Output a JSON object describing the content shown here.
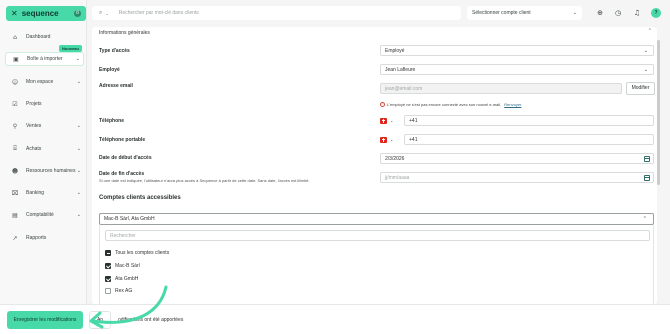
{
  "brand": {
    "name": "sequence",
    "mark": "✕",
    "badge": "8"
  },
  "colors": {
    "accent": "#47d9a8",
    "accent_dark": "#0e3b30",
    "warning": "#d34a3e",
    "link": "#2f6d8a"
  },
  "sidebar": {
    "new_badge": "Nouveau",
    "items": [
      {
        "label": "Dashboard",
        "icon": "home-icon",
        "glyph": "⌂",
        "chevron": false
      },
      {
        "label": "Boîte à importer",
        "icon": "inbox-icon",
        "glyph": "▣",
        "chevron": true
      },
      {
        "label": "Mon espace",
        "icon": "user-icon",
        "glyph": "☺",
        "chevron": true
      },
      {
        "label": "Projets",
        "icon": "projects-icon",
        "glyph": "☑",
        "chevron": false
      },
      {
        "label": "Ventes",
        "icon": "sales-icon",
        "glyph": "⚲",
        "chevron": true
      },
      {
        "label": "Achats",
        "icon": "purchases-icon",
        "glyph": "⌸",
        "chevron": true
      },
      {
        "label": "Ressources humaines",
        "icon": "hr-icon",
        "glyph": "☻",
        "chevron": true
      },
      {
        "label": "Banking",
        "icon": "bank-icon",
        "glyph": "⌧",
        "chevron": true
      },
      {
        "label": "Comptabilité",
        "icon": "accounting-icon",
        "glyph": "▤",
        "chevron": true
      },
      {
        "label": "Rapports",
        "icon": "chart-icon",
        "glyph": "↗",
        "chevron": false
      }
    ]
  },
  "topbar": {
    "search_placeholder": "Rechercher par mot-clé dans clients",
    "account_select": "Sélectionner compte client",
    "help_label": "?"
  },
  "section": {
    "header": "Informations générales"
  },
  "form": {
    "access_type": {
      "label": "Type d'accès",
      "value": "Employé"
    },
    "employee": {
      "label": "Employé",
      "value": "Jean Lafleure"
    },
    "email": {
      "label": "Adresse email",
      "value": "jean@email.com",
      "modify": "Modifier"
    },
    "warning": {
      "text": "L'employé ne s'est pas encore connecté avec son nouvel e-mail.",
      "link": "Renvoyer"
    },
    "phone": {
      "label": "Téléphone",
      "prefix": "+41"
    },
    "mobile": {
      "label": "Téléphone portable",
      "prefix": "+41"
    },
    "start_date": {
      "label": "Date de début d'accès",
      "value": "2/3/2026"
    },
    "end_date": {
      "label": "Date de fin d'accès",
      "sub": "Si une date est indiquée, l'utilisateur n'aura plus accès à Sequence à partir de cette date. Sans date, l'accès est illimité.",
      "placeholder": "jj/mm/aaaa"
    }
  },
  "accounts": {
    "title": "Comptes clients accessibles",
    "selected": "Mac-B Sàrl, Ata GmbH",
    "dropdown_search_placeholder": "Rechercher",
    "all_label": "Tous les comptes clients",
    "options": [
      {
        "label": "Mac-B Sàrl",
        "checked": true
      },
      {
        "label": "Ata GmbH",
        "checked": true
      },
      {
        "label": "Rex AG",
        "checked": false
      }
    ]
  },
  "footer": {
    "save": "Enregistrer les modifications",
    "cancel": "An",
    "note": "odifications ont été apportées"
  }
}
